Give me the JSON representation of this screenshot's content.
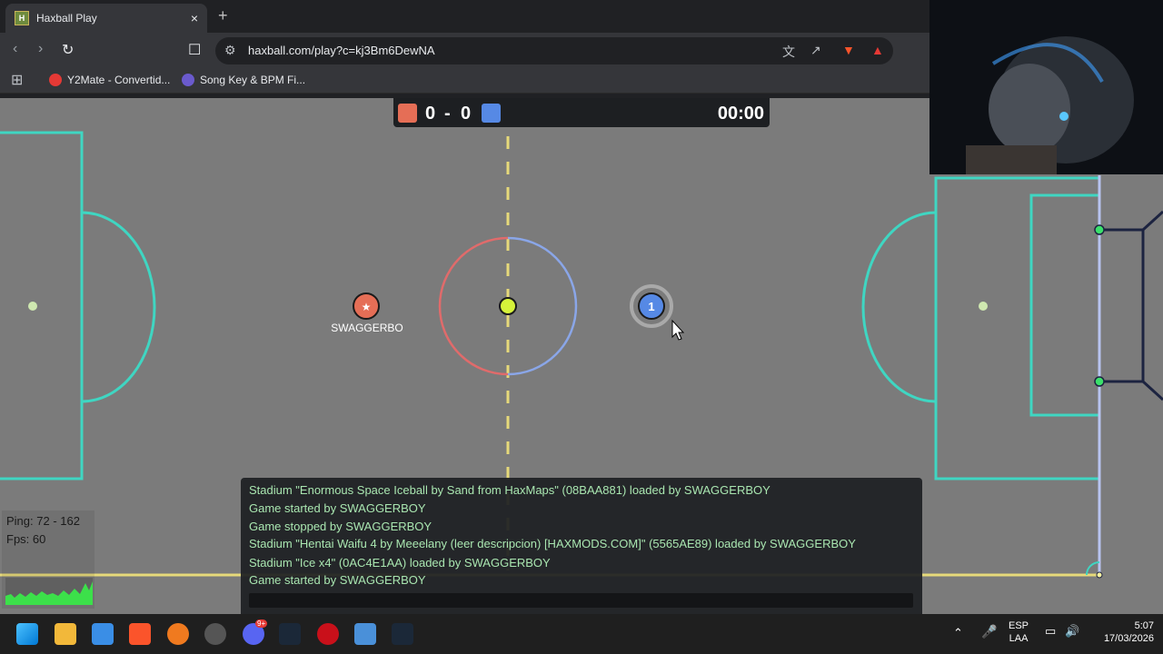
{
  "browser": {
    "tab_title": "Haxball Play",
    "tab_favicon": "H",
    "tab_close": "×",
    "new_tab": "+",
    "url": "haxball.com/play?c=kj3Bm6DewNA",
    "bookmarks": [
      {
        "label": "Y2Mate - Convertid...",
        "color": "#e53935"
      },
      {
        "label": "Song Key & BPM Fi...",
        "color": "#6a5acd"
      }
    ]
  },
  "scoreboard": {
    "red_score": "0",
    "separator": "-",
    "blue_score": "0",
    "time": "00:00",
    "red_color": "#e56e56",
    "blue_color": "#5689e5"
  },
  "players": {
    "red_name": "SWAGGERBO",
    "blue_number": "1"
  },
  "stats": {
    "ping": "Ping: 72 - 162",
    "fps": "Fps: 60"
  },
  "chat": {
    "messages": [
      "Stadium \"Enormous Space Iceball by Sand from HaxMaps\" (08BAA881) loaded by SWAGGERBOY",
      "Game started by SWAGGERBOY",
      "Game stopped by SWAGGERBOY",
      "Stadium \"Hentai Waifu 4 by Meeelany (leer descripcion) [HAXMODS.COM]\" (5565AE89) loaded by SWAGGERBOY",
      "Stadium \"Ice x4\" (0AC4E1AA) loaded by SWAGGERBOY",
      "Game started by SWAGGERBOY"
    ]
  },
  "taskbar": {
    "language_top": "ESP",
    "language_bottom": "LAA",
    "time": "5:07",
    "date": "17/03/2026",
    "discord_badge": "9+"
  }
}
